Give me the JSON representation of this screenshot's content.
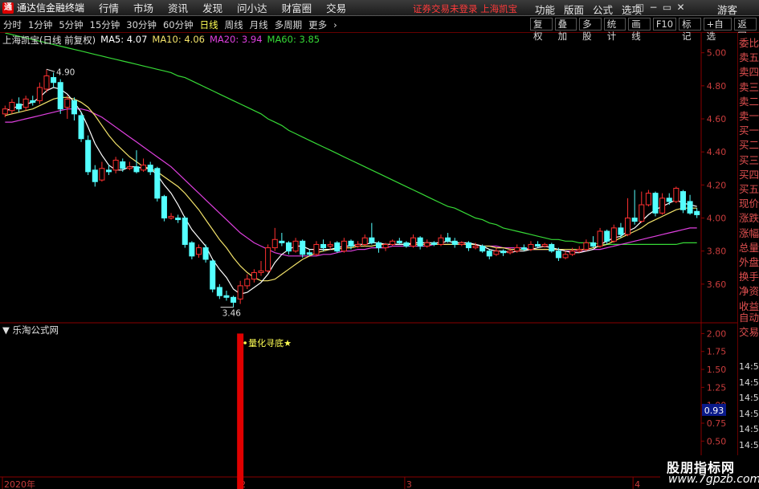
{
  "app": {
    "title": "通达信金融终端",
    "logo": "tdx-logo-icon"
  },
  "menubar": {
    "items": [
      "行情",
      "市场",
      "资讯",
      "发现",
      "问小达",
      "财富圈",
      "交易"
    ],
    "notice": "证券交易未登录  上海凯宝",
    "right_items": [
      "功能",
      "版面",
      "公式",
      "选项"
    ],
    "window_buttons": [
      "□",
      "−",
      "▭",
      "✕"
    ],
    "guest": "游客"
  },
  "toolbar": {
    "periods": [
      "分时",
      "1分钟",
      "5分钟",
      "15分钟",
      "30分钟",
      "60分钟",
      "日线",
      "周线",
      "月线",
      "多周期",
      "更多"
    ],
    "active": "日线",
    "more_icon": "chevron-right-icon",
    "right_buttons": [
      "复权",
      "叠加",
      "多股",
      "统计",
      "画线",
      "F10",
      "标记",
      "+自选",
      "返回"
    ]
  },
  "legend": {
    "stock": "上海凯宝(日线 前复权)",
    "ma5": "MA5: 4.07",
    "ma10": "MA10: 4.06",
    "ma20": "MA20: 3.94",
    "ma60": "MA60: 3.85"
  },
  "indicator": {
    "title": "乐淘公式网",
    "signal_label": "量化寻底★"
  },
  "price_axis": {
    "labels": [
      "5.00",
      "4.80",
      "4.60",
      "4.40",
      "4.20",
      "4.00",
      "3.80",
      "3.60"
    ]
  },
  "indicator_axis": {
    "labels": [
      "2.00",
      "1.75",
      "1.50",
      "1.25",
      "1.00",
      "0.75",
      "0.50",
      "0.25"
    ],
    "current": "0.93"
  },
  "x_axis": {
    "labels": [
      "2020年",
      "2",
      "3",
      "4"
    ]
  },
  "annotations": {
    "high": "4.90",
    "low": "3.46"
  },
  "right_panel": {
    "items": [
      "委比",
      "卖五",
      "卖四",
      "卖三",
      "卖二",
      "卖一",
      "买一",
      "买二",
      "买三",
      "买四",
      "买五",
      "现价",
      "涨跌",
      "涨幅",
      "总量",
      "外盘",
      "换手",
      "净资",
      "收益",
      "自动",
      "交易"
    ],
    "times": [
      "14:56",
      "14:56",
      "14:56",
      "14:56",
      "14:56",
      "14:56",
      "14:56",
      "14:56",
      "14:56"
    ]
  },
  "watermark": {
    "cn": "股朋指标网",
    "url": "www.7gpzb.com"
  },
  "colors": {
    "up": "#ff3030",
    "down": "#54ffff",
    "ma5": "#ffffff",
    "ma10": "#f3e36a",
    "ma20": "#e040e0",
    "ma60": "#36d936",
    "signal": "#e00000"
  },
  "chart_data": {
    "type": "candlestick",
    "price_range": [
      3.4,
      5.12
    ],
    "candles": [
      {
        "o": 4.63,
        "c": 4.66,
        "h": 4.68,
        "l": 4.61
      },
      {
        "o": 4.65,
        "c": 4.7,
        "h": 4.72,
        "l": 4.63
      },
      {
        "o": 4.69,
        "c": 4.66,
        "h": 4.73,
        "l": 4.64
      },
      {
        "o": 4.67,
        "c": 4.72,
        "h": 4.74,
        "l": 4.65
      },
      {
        "o": 4.71,
        "c": 4.7,
        "h": 4.74,
        "l": 4.68
      },
      {
        "o": 4.71,
        "c": 4.79,
        "h": 4.82,
        "l": 4.69
      },
      {
        "o": 4.78,
        "c": 4.86,
        "h": 4.9,
        "l": 4.76
      },
      {
        "o": 4.85,
        "c": 4.82,
        "h": 4.88,
        "l": 4.79
      },
      {
        "o": 4.82,
        "c": 4.66,
        "h": 4.84,
        "l": 4.63
      },
      {
        "o": 4.67,
        "c": 4.72,
        "h": 4.74,
        "l": 4.6
      },
      {
        "o": 4.71,
        "c": 4.63,
        "h": 4.73,
        "l": 4.59
      },
      {
        "o": 4.62,
        "c": 4.48,
        "h": 4.64,
        "l": 4.46
      },
      {
        "o": 4.47,
        "c": 4.28,
        "h": 4.5,
        "l": 4.26
      },
      {
        "o": 4.29,
        "c": 4.22,
        "h": 4.32,
        "l": 4.19
      },
      {
        "o": 4.23,
        "c": 4.3,
        "h": 4.34,
        "l": 4.22
      },
      {
        "o": 4.29,
        "c": 4.28,
        "h": 4.32,
        "l": 4.26
      },
      {
        "o": 4.29,
        "c": 4.35,
        "h": 4.37,
        "l": 4.27
      },
      {
        "o": 4.34,
        "c": 4.3,
        "h": 4.36,
        "l": 4.28
      },
      {
        "o": 4.3,
        "c": 4.31,
        "h": 4.34,
        "l": 4.29
      },
      {
        "o": 4.31,
        "c": 4.28,
        "h": 4.41,
        "l": 4.27
      },
      {
        "o": 4.29,
        "c": 4.32,
        "h": 4.36,
        "l": 4.28
      },
      {
        "o": 4.32,
        "c": 4.28,
        "h": 4.34,
        "l": 4.26
      },
      {
        "o": 4.3,
        "c": 4.12,
        "h": 4.31,
        "l": 4.1
      },
      {
        "o": 4.13,
        "c": 4.0,
        "h": 4.14,
        "l": 3.98
      },
      {
        "o": 4.0,
        "c": 4.01,
        "h": 4.03,
        "l": 3.99
      },
      {
        "o": 4.0,
        "c": 3.99,
        "h": 4.02,
        "l": 3.97
      },
      {
        "o": 4.0,
        "c": 3.84,
        "h": 4.01,
        "l": 3.82
      },
      {
        "o": 3.85,
        "c": 3.77,
        "h": 3.86,
        "l": 3.75
      },
      {
        "o": 3.78,
        "c": 3.82,
        "h": 3.84,
        "l": 3.76
      },
      {
        "o": 3.82,
        "c": 3.75,
        "h": 3.84,
        "l": 3.73
      },
      {
        "o": 3.74,
        "c": 3.57,
        "h": 3.75,
        "l": 3.55
      },
      {
        "o": 3.58,
        "c": 3.53,
        "h": 3.6,
        "l": 3.51
      },
      {
        "o": 3.53,
        "c": 3.52,
        "h": 3.56,
        "l": 3.5
      },
      {
        "o": 3.52,
        "c": 3.49,
        "h": 3.53,
        "l": 3.46
      },
      {
        "o": 3.51,
        "c": 3.59,
        "h": 3.62,
        "l": 3.48
      },
      {
        "o": 3.59,
        "c": 3.63,
        "h": 3.66,
        "l": 3.57
      },
      {
        "o": 3.63,
        "c": 3.67,
        "h": 3.69,
        "l": 3.61
      },
      {
        "o": 3.67,
        "c": 3.68,
        "h": 3.74,
        "l": 3.65
      },
      {
        "o": 3.68,
        "c": 3.82,
        "h": 3.84,
        "l": 3.67
      },
      {
        "o": 3.82,
        "c": 3.87,
        "h": 3.94,
        "l": 3.8
      },
      {
        "o": 3.86,
        "c": 3.85,
        "h": 3.91,
        "l": 3.83
      },
      {
        "o": 3.85,
        "c": 3.8,
        "h": 3.86,
        "l": 3.78
      },
      {
        "o": 3.8,
        "c": 3.86,
        "h": 3.88,
        "l": 3.79
      },
      {
        "o": 3.86,
        "c": 3.78,
        "h": 3.87,
        "l": 3.76
      },
      {
        "o": 3.79,
        "c": 3.78,
        "h": 3.81,
        "l": 3.77
      },
      {
        "o": 3.78,
        "c": 3.84,
        "h": 3.86,
        "l": 3.77
      },
      {
        "o": 3.84,
        "c": 3.82,
        "h": 3.87,
        "l": 3.8
      },
      {
        "o": 3.83,
        "c": 3.84,
        "h": 3.86,
        "l": 3.81
      },
      {
        "o": 3.85,
        "c": 3.8,
        "h": 3.86,
        "l": 3.79
      },
      {
        "o": 3.8,
        "c": 3.86,
        "h": 3.88,
        "l": 3.79
      },
      {
        "o": 3.86,
        "c": 3.83,
        "h": 3.87,
        "l": 3.81
      },
      {
        "o": 3.83,
        "c": 3.84,
        "h": 3.86,
        "l": 3.82
      },
      {
        "o": 3.84,
        "c": 3.88,
        "h": 3.9,
        "l": 3.83
      },
      {
        "o": 3.88,
        "c": 3.85,
        "h": 3.97,
        "l": 3.84
      },
      {
        "o": 3.85,
        "c": 3.82,
        "h": 3.86,
        "l": 3.79
      },
      {
        "o": 3.82,
        "c": 3.84,
        "h": 3.85,
        "l": 3.8
      },
      {
        "o": 3.84,
        "c": 3.86,
        "h": 3.87,
        "l": 3.83
      },
      {
        "o": 3.86,
        "c": 3.85,
        "h": 3.88,
        "l": 3.84
      },
      {
        "o": 3.85,
        "c": 3.83,
        "h": 3.86,
        "l": 3.82
      },
      {
        "o": 3.83,
        "c": 3.88,
        "h": 3.9,
        "l": 3.82
      },
      {
        "o": 3.88,
        "c": 3.83,
        "h": 3.89,
        "l": 3.81
      },
      {
        "o": 3.83,
        "c": 3.85,
        "h": 3.87,
        "l": 3.82
      },
      {
        "o": 3.85,
        "c": 3.84,
        "h": 3.86,
        "l": 3.83
      },
      {
        "o": 3.84,
        "c": 3.88,
        "h": 3.9,
        "l": 3.83
      },
      {
        "o": 3.88,
        "c": 3.86,
        "h": 3.91,
        "l": 3.85
      },
      {
        "o": 3.86,
        "c": 3.84,
        "h": 3.88,
        "l": 3.82
      },
      {
        "o": 3.84,
        "c": 3.85,
        "h": 3.86,
        "l": 3.83
      },
      {
        "o": 3.85,
        "c": 3.82,
        "h": 3.86,
        "l": 3.8
      },
      {
        "o": 3.82,
        "c": 3.83,
        "h": 3.85,
        "l": 3.81
      },
      {
        "o": 3.83,
        "c": 3.8,
        "h": 3.84,
        "l": 3.79
      },
      {
        "o": 3.8,
        "c": 3.77,
        "h": 3.81,
        "l": 3.75
      },
      {
        "o": 3.78,
        "c": 3.8,
        "h": 3.82,
        "l": 3.77
      },
      {
        "o": 3.8,
        "c": 3.79,
        "h": 3.81,
        "l": 3.77
      },
      {
        "o": 3.79,
        "c": 3.8,
        "h": 3.82,
        "l": 3.78
      },
      {
        "o": 3.8,
        "c": 3.82,
        "h": 3.84,
        "l": 3.79
      },
      {
        "o": 3.82,
        "c": 3.81,
        "h": 3.84,
        "l": 3.8
      },
      {
        "o": 3.81,
        "c": 3.84,
        "h": 3.86,
        "l": 3.8
      },
      {
        "o": 3.84,
        "c": 3.83,
        "h": 3.86,
        "l": 3.82
      },
      {
        "o": 3.83,
        "c": 3.84,
        "h": 3.85,
        "l": 3.82
      },
      {
        "o": 3.84,
        "c": 3.8,
        "h": 3.85,
        "l": 3.79
      },
      {
        "o": 3.8,
        "c": 3.76,
        "h": 3.82,
        "l": 3.74
      },
      {
        "o": 3.76,
        "c": 3.78,
        "h": 3.8,
        "l": 3.75
      },
      {
        "o": 3.78,
        "c": 3.8,
        "h": 3.82,
        "l": 3.77
      },
      {
        "o": 3.8,
        "c": 3.81,
        "h": 3.83,
        "l": 3.79
      },
      {
        "o": 3.81,
        "c": 3.85,
        "h": 3.87,
        "l": 3.8
      },
      {
        "o": 3.85,
        "c": 3.83,
        "h": 3.89,
        "l": 3.82
      },
      {
        "o": 3.83,
        "c": 3.92,
        "h": 3.94,
        "l": 3.82
      },
      {
        "o": 3.92,
        "c": 3.86,
        "h": 3.93,
        "l": 3.84
      },
      {
        "o": 3.86,
        "c": 3.94,
        "h": 3.96,
        "l": 3.85
      },
      {
        "o": 3.94,
        "c": 3.9,
        "h": 3.97,
        "l": 3.88
      },
      {
        "o": 3.9,
        "c": 4.0,
        "h": 4.12,
        "l": 3.89
      },
      {
        "o": 4.0,
        "c": 3.98,
        "h": 4.17,
        "l": 3.96
      },
      {
        "o": 3.98,
        "c": 4.08,
        "h": 4.16,
        "l": 3.97
      },
      {
        "o": 4.08,
        "c": 4.15,
        "h": 4.17,
        "l": 4.07
      },
      {
        "o": 4.15,
        "c": 4.03,
        "h": 4.16,
        "l": 4.01
      },
      {
        "o": 4.03,
        "c": 4.12,
        "h": 4.15,
        "l": 4.02
      },
      {
        "o": 4.12,
        "c": 4.1,
        "h": 4.15,
        "l": 4.08
      },
      {
        "o": 4.1,
        "c": 4.18,
        "h": 4.19,
        "l": 4.09
      },
      {
        "o": 4.16,
        "c": 4.05,
        "h": 4.17,
        "l": 4.03
      },
      {
        "o": 4.1,
        "c": 4.03,
        "h": 4.14,
        "l": 4.02
      },
      {
        "o": 4.04,
        "c": 4.02,
        "h": 4.06,
        "l": 4.0
      }
    ],
    "ma5": [
      4.65,
      4.66,
      4.68,
      4.69,
      4.7,
      4.73,
      4.77,
      4.79,
      4.78,
      4.75,
      4.7,
      4.64,
      4.55,
      4.45,
      4.38,
      4.32,
      4.29,
      4.29,
      4.31,
      4.31,
      4.3,
      4.3,
      4.26,
      4.2,
      4.15,
      4.08,
      4.0,
      3.93,
      3.88,
      3.83,
      3.75,
      3.69,
      3.64,
      3.57,
      3.54,
      3.55,
      3.58,
      3.61,
      3.66,
      3.73,
      3.78,
      3.81,
      3.83,
      3.83,
      3.81,
      3.81,
      3.81,
      3.81,
      3.82,
      3.83,
      3.83,
      3.84,
      3.84,
      3.85,
      3.85,
      3.84,
      3.84,
      3.84,
      3.84,
      3.85,
      3.85,
      3.85,
      3.85,
      3.85,
      3.86,
      3.85,
      3.85,
      3.85,
      3.84,
      3.83,
      3.81,
      3.8,
      3.8,
      3.79,
      3.8,
      3.8,
      3.81,
      3.82,
      3.83,
      3.82,
      3.81,
      3.8,
      3.79,
      3.79,
      3.8,
      3.81,
      3.84,
      3.86,
      3.88,
      3.89,
      3.92,
      3.94,
      3.98,
      4.02,
      4.05,
      4.07,
      4.09,
      4.11,
      4.09,
      4.08,
      4.07
    ],
    "ma10": [
      4.62,
      4.63,
      4.64,
      4.65,
      4.66,
      4.68,
      4.7,
      4.72,
      4.73,
      4.73,
      4.72,
      4.7,
      4.67,
      4.62,
      4.56,
      4.5,
      4.45,
      4.41,
      4.37,
      4.34,
      4.31,
      4.3,
      4.28,
      4.25,
      4.22,
      4.19,
      4.15,
      4.1,
      4.05,
      3.99,
      3.93,
      3.87,
      3.82,
      3.76,
      3.71,
      3.67,
      3.64,
      3.62,
      3.62,
      3.63,
      3.66,
      3.69,
      3.72,
      3.75,
      3.77,
      3.79,
      3.8,
      3.81,
      3.81,
      3.82,
      3.82,
      3.83,
      3.83,
      3.83,
      3.84,
      3.84,
      3.84,
      3.84,
      3.84,
      3.84,
      3.84,
      3.84,
      3.84,
      3.84,
      3.84,
      3.84,
      3.84,
      3.84,
      3.84,
      3.83,
      3.83,
      3.82,
      3.82,
      3.81,
      3.81,
      3.81,
      3.81,
      3.81,
      3.81,
      3.81,
      3.81,
      3.81,
      3.81,
      3.81,
      3.81,
      3.82,
      3.83,
      3.84,
      3.86,
      3.88,
      3.9,
      3.92,
      3.94,
      3.97,
      3.99,
      4.01,
      4.03,
      4.05,
      4.06,
      4.06,
      4.06
    ],
    "ma20": [
      4.58,
      4.58,
      4.59,
      4.6,
      4.61,
      4.62,
      4.63,
      4.64,
      4.65,
      4.66,
      4.66,
      4.66,
      4.65,
      4.63,
      4.61,
      4.58,
      4.55,
      4.52,
      4.49,
      4.46,
      4.43,
      4.4,
      4.37,
      4.34,
      4.31,
      4.27,
      4.23,
      4.19,
      4.15,
      4.11,
      4.07,
      4.03,
      3.99,
      3.95,
      3.91,
      3.88,
      3.85,
      3.83,
      3.81,
      3.79,
      3.78,
      3.77,
      3.77,
      3.77,
      3.77,
      3.77,
      3.78,
      3.78,
      3.79,
      3.8,
      3.8,
      3.81,
      3.81,
      3.82,
      3.82,
      3.82,
      3.83,
      3.83,
      3.83,
      3.83,
      3.83,
      3.83,
      3.84,
      3.84,
      3.84,
      3.84,
      3.84,
      3.84,
      3.84,
      3.83,
      3.83,
      3.83,
      3.82,
      3.82,
      3.82,
      3.82,
      3.81,
      3.81,
      3.81,
      3.81,
      3.81,
      3.8,
      3.8,
      3.8,
      3.8,
      3.81,
      3.81,
      3.82,
      3.83,
      3.84,
      3.85,
      3.86,
      3.87,
      3.88,
      3.89,
      3.9,
      3.91,
      3.92,
      3.93,
      3.94,
      3.94
    ],
    "ma60": [
      5.12,
      5.11,
      5.1,
      5.09,
      5.08,
      5.07,
      5.06,
      5.05,
      5.04,
      5.03,
      5.02,
      5.01,
      5.0,
      4.99,
      4.98,
      4.97,
      4.96,
      4.95,
      4.94,
      4.93,
      4.92,
      4.91,
      4.9,
      4.89,
      4.88,
      4.86,
      4.85,
      4.83,
      4.81,
      4.79,
      4.77,
      4.75,
      4.73,
      4.71,
      4.69,
      4.67,
      4.65,
      4.63,
      4.6,
      4.58,
      4.56,
      4.53,
      4.51,
      4.49,
      4.47,
      4.45,
      4.43,
      4.41,
      4.39,
      4.37,
      4.35,
      4.33,
      4.31,
      4.29,
      4.27,
      4.25,
      4.23,
      4.21,
      4.19,
      4.17,
      4.15,
      4.13,
      4.11,
      4.09,
      4.07,
      4.06,
      4.04,
      4.02,
      4.0,
      3.99,
      3.97,
      3.96,
      3.94,
      3.93,
      3.92,
      3.91,
      3.9,
      3.89,
      3.88,
      3.87,
      3.87,
      3.86,
      3.86,
      3.85,
      3.85,
      3.85,
      3.84,
      3.84,
      3.84,
      3.84,
      3.84,
      3.84,
      3.84,
      3.84,
      3.84,
      3.84,
      3.84,
      3.84,
      3.85,
      3.85,
      3.85
    ],
    "signal": {
      "index": 34,
      "value": 2.0
    },
    "indicator_range": [
      0,
      2.15
    ]
  }
}
